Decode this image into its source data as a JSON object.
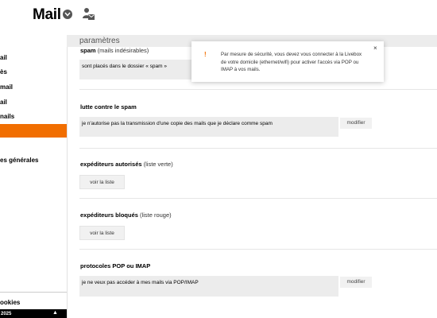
{
  "app": {
    "title": "Mail"
  },
  "sidebar": {
    "items": [
      {
        "label": "ail"
      },
      {
        "label": "ès"
      },
      {
        "label": " mail"
      },
      {
        "label": "ail"
      },
      {
        "label": "nails"
      },
      {
        "label": ""
      },
      {
        "label": "es générales"
      }
    ],
    "cookies_label": "ookies",
    "bottom_text": "2025",
    "bottom_arrow": "▲",
    "active_color": "#f16e00"
  },
  "header": {
    "title": "paramètres"
  },
  "sections": {
    "spam": {
      "title": "spam",
      "subtitle": "(mails indésirables)",
      "value": "sont placés dans le dossier « spam »"
    },
    "anti_spam": {
      "title": "lutte contre le spam",
      "value": "je n'autorise pas la transmission d'une copie des mails que je déclare comme spam",
      "button": "modifier"
    },
    "whitelist": {
      "title": "expéditeurs autorisés",
      "subtitle": "(liste verte)",
      "button": "voir la liste"
    },
    "blacklist": {
      "title": "expéditeurs bloqués",
      "subtitle": "(liste rouge)",
      "button": "voir la liste"
    },
    "pop_imap": {
      "title": "protocoles POP ou IMAP",
      "value": "je ne veux pas accéder à mes mails via POP/IMAP",
      "button": "modifier"
    }
  },
  "toast": {
    "icon": "!",
    "message": "Par mesure de sécurité, vous devez vous connecter à la Livebox de votre domicile (ethernet/wifi) pour activer l'accès via POP ou IMAP à vos mails.",
    "close": "×"
  }
}
